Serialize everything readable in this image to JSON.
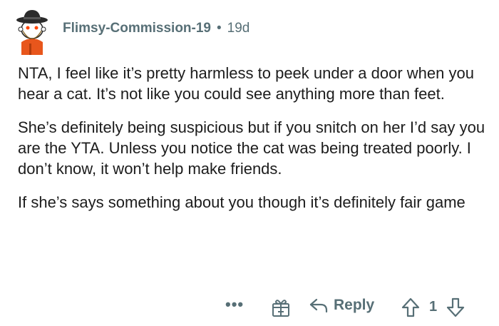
{
  "comment": {
    "author": "Flimsy-Commission-19",
    "separator": "•",
    "age": "19d",
    "avatar_icon": "snoo-avatar-icon",
    "paragraphs": [
      "NTA, I feel like it’s pretty harmless to peek under a door when you hear a cat. It’s not like you could see anything more than feet.",
      "She’s definitely being suspicious but if you snitch on her I’d say you are the YTA. Unless you notice the cat was being treated poorly. I don’t know, it won’t help make friends.",
      "If she’s says something about you though it’s definitely fair game"
    ]
  },
  "actions": {
    "more_label": "•••",
    "award_icon": "gift-icon",
    "reply_icon": "reply-arrow-icon",
    "reply_label": "Reply",
    "upvote_icon": "upvote-arrow-icon",
    "score": "1",
    "downvote_icon": "downvote-arrow-icon"
  },
  "colors": {
    "meta": "#576f76",
    "text": "#1c1c1c",
    "avatar_hat": "#2b2b2b",
    "avatar_shirt": "#e8561c"
  }
}
